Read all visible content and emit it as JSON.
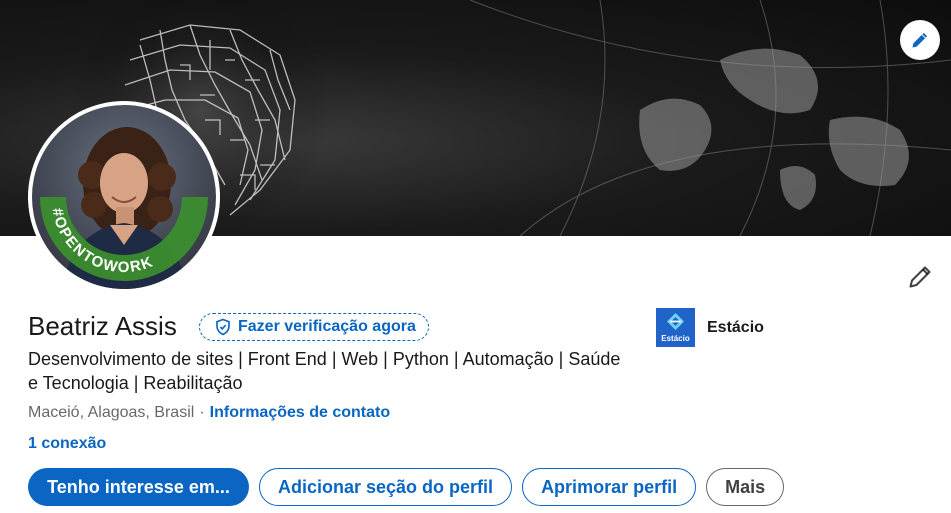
{
  "profile": {
    "name": "Beatriz Assis",
    "verify_label": "Fazer verificação agora",
    "headline": "Desenvolvimento de sites | Front End | Web | Python | Automação | Saúde e Tecnologia | Reabilitação",
    "location": "Maceió, Alagoas, Brasil",
    "separator": "·",
    "contact_link": "Informações de contato",
    "connections": "1 conexão",
    "open_to_work_badge": "#OPENTOWORK"
  },
  "education": {
    "name": "Estácio",
    "logo_text": "Estácio"
  },
  "actions": {
    "primary": "Tenho interesse em...",
    "add_section": "Adicionar seção do perfil",
    "enhance": "Aprimorar perfil",
    "more": "Mais"
  },
  "icons": {
    "banner_edit": "pencil-icon",
    "section_edit": "pencil-icon",
    "verify": "shield-check-icon"
  },
  "colors": {
    "brand_blue": "#0a66c2",
    "open_to_work_green": "#3b8d2f",
    "education_logo": "#2063c9"
  }
}
